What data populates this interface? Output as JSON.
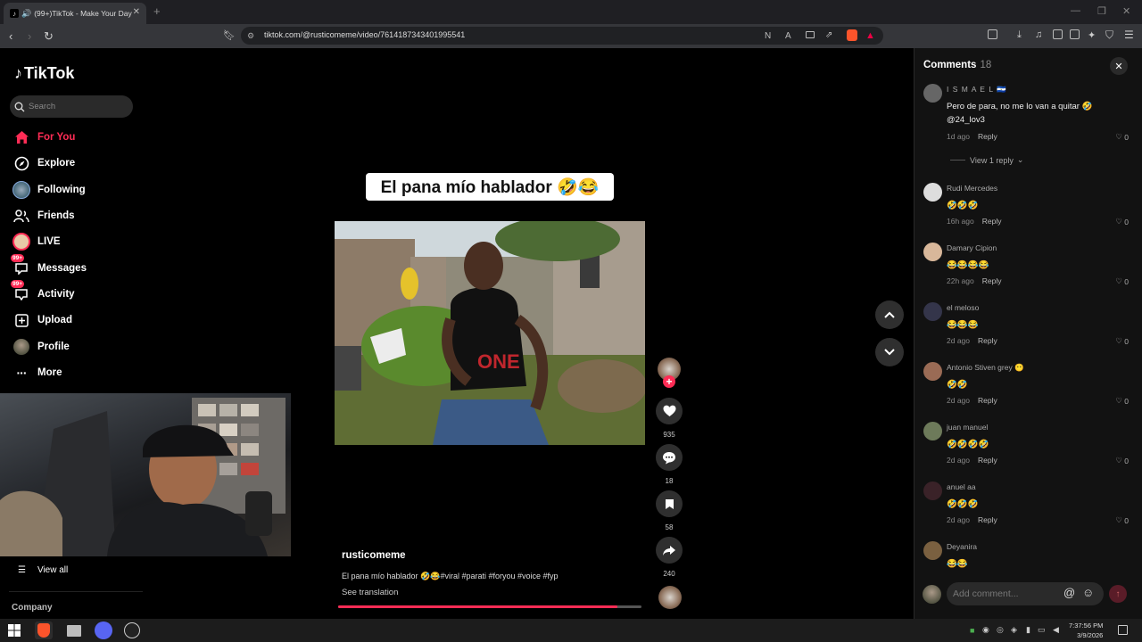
{
  "browser": {
    "tab_title": "(99+)TikTok - Make Your Day",
    "url": "tiktok.com/@rusticomeme/video/7614187343401995541"
  },
  "sidebar": {
    "logo_text": "TikTok",
    "search_placeholder": "Search",
    "items": [
      {
        "label": "For You",
        "icon": "home-icon",
        "active": true
      },
      {
        "label": "Explore",
        "icon": "compass-icon"
      },
      {
        "label": "Following",
        "icon": "following-avatar-icon"
      },
      {
        "label": "Friends",
        "icon": "friends-icon"
      },
      {
        "label": "LIVE",
        "icon": "live-icon"
      },
      {
        "label": "Messages",
        "icon": "messages-icon",
        "badge": "99+"
      },
      {
        "label": "Activity",
        "icon": "activity-icon",
        "badge": "99+"
      },
      {
        "label": "Upload",
        "icon": "upload-icon"
      },
      {
        "label": "Profile",
        "icon": "profile-avatar-icon"
      },
      {
        "label": "More",
        "icon": "more-icon"
      }
    ],
    "view_all": "View all",
    "company": "Company"
  },
  "video": {
    "overlay_caption": "El pana mío hablador 🤣😂",
    "author": "rusticomeme",
    "description": "El pana mío hablador 🤣😂#viral #parati #foryou #voice #fyp",
    "see_translation": "See translation",
    "progress": 0.92,
    "likes": "935",
    "comments": "18",
    "saves": "58",
    "shares": "240"
  },
  "comments_panel": {
    "title": "Comments",
    "count": "18",
    "view_reply": "View 1 reply",
    "add_placeholder": "Add comment...",
    "items": [
      {
        "name": "I S M A E L 🇸🇻",
        "text": "Pero de para, no me lo van a quitar 🤣 @24_lov3",
        "time": "1d ago",
        "reply": "Reply",
        "likes": "0"
      },
      {
        "name": "Rudi Mercedes",
        "text": "🤣🤣🤣",
        "time": "16h ago",
        "reply": "Reply",
        "likes": "0"
      },
      {
        "name": "Damary Cipion",
        "text": "😂😂😂😂",
        "time": "22h ago",
        "reply": "Reply",
        "likes": "0"
      },
      {
        "name": "el meloso",
        "text": "😂😂😂",
        "time": "2d ago",
        "reply": "Reply",
        "likes": "0"
      },
      {
        "name": "Antonio Stiven grey 😶",
        "text": "🤣🤣",
        "time": "2d ago",
        "reply": "Reply",
        "likes": "0"
      },
      {
        "name": "juan manuel",
        "text": "🤣🤣🤣🤣",
        "time": "2d ago",
        "reply": "Reply",
        "likes": "0"
      },
      {
        "name": "anuel aa",
        "text": "🤣🤣🤣",
        "time": "2d ago",
        "reply": "Reply",
        "likes": "0"
      },
      {
        "name": "Deyanira",
        "text": "😂😂",
        "time": "",
        "reply": "",
        "likes": ""
      }
    ]
  },
  "taskbar": {
    "time": "7:37:56 PM",
    "date": "3/9/2026"
  },
  "colors": {
    "accent": "#fe2c55",
    "panel": "#121212"
  }
}
